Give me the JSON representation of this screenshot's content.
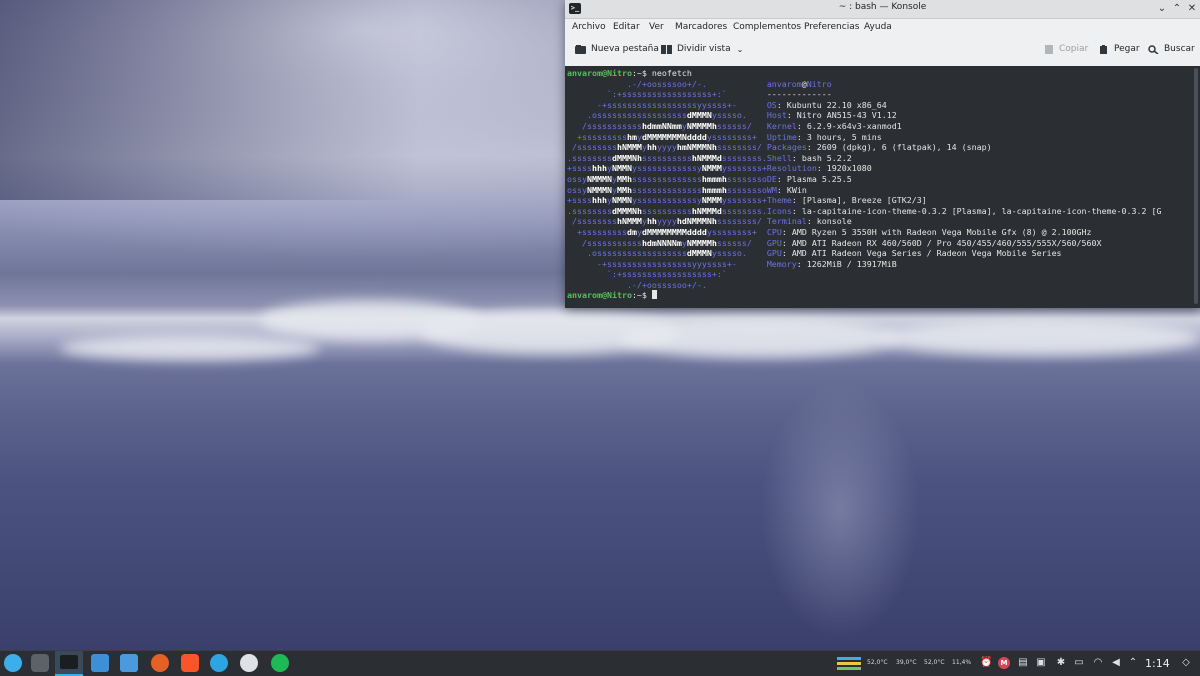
{
  "window": {
    "title": "~ : bash — Konsole",
    "title_icon": ">_",
    "controls": {
      "menu": "⌄",
      "minimize": "⌃",
      "close": "✕"
    }
  },
  "menubar": [
    "Archivo",
    "Editar",
    "Ver",
    "Marcadores",
    "Complementos",
    "Preferencias",
    "Ayuda"
  ],
  "toolbar": {
    "new_tab": "Nueva pestaña",
    "split_view": "Dividir vista",
    "copy": "Copiar",
    "paste": "Pegar",
    "search": "Buscar"
  },
  "terminal": {
    "user": "anvarom@Nitro",
    "prompt_suffix": ":~$",
    "command": "neofetch",
    "info_header": "anvarom@Nitro",
    "info_separator": "-------------",
    "info": [
      {
        "label": "OS",
        "value": "Kubuntu 22.10 x86_64"
      },
      {
        "label": "Host",
        "value": "Nitro AN515-43 V1.12"
      },
      {
        "label": "Kernel",
        "value": "6.2.9-x64v3-xanmod1"
      },
      {
        "label": "Uptime",
        "value": "3 hours, 5 mins"
      },
      {
        "label": "Packages",
        "value": "2609 (dpkg), 6 (flatpak), 14 (snap)"
      },
      {
        "label": "Shell",
        "value": "bash 5.2.2"
      },
      {
        "label": "Resolution",
        "value": "1920x1080"
      },
      {
        "label": "DE",
        "value": "Plasma 5.25.5"
      },
      {
        "label": "WM",
        "value": "KWin"
      },
      {
        "label": "Theme",
        "value": "[Plasma], Breeze [GTK2/3]"
      },
      {
        "label": "Icons",
        "value": "la-capitaine-icon-theme-0.3.2 [Plasma], la-capitaine-icon-theme-0.3.2 [G"
      },
      {
        "label": "Terminal",
        "value": "konsole"
      },
      {
        "label": "CPU",
        "value": "AMD Ryzen 5 3550H with Radeon Vega Mobile Gfx (8) @ 2.100GHz"
      },
      {
        "label": "GPU",
        "value": "AMD ATI Radeon RX 460/560D / Pro 450/455/460/555/555X/560/560X"
      },
      {
        "label": "GPU",
        "value": "AMD ATI Radeon Vega Series / Radeon Vega Mobile Series"
      },
      {
        "label": "Memory",
        "value": "1262MiB / 13917MiB"
      }
    ],
    "logo": [
      "            .-/+oossssoo+/-.",
      "        `:+ssssssssssssssssss+:`",
      "      -+ssssssssssssssssssyyssss+-",
      "    .ossssssssssssssssssdMMMNysssso.",
      "   /ssssssssssshdmmNNmmyNMMMMhssssss/",
      "  +ssssssssshmydMMMMMMMNddddyssssssss+",
      " /sssssssshNMMMyhhyyyyhmNMMMNhssssssss/",
      ".ssssssssdMMMNhsssssssssshNMMMdssssssss.",
      "+sssshhhyNMMNyssssssssssssyNMMMysssssss+",
      "ossyNMMMNyMMhsssssssssssssshmmmhssssssso",
      "ossyNMMMNyMMhsssssssssssssshmmmhssssssso",
      "+sssshhhyNMMNyssssssssssssyNMMMysssssss+",
      ".ssssssssdMMMNhsssssssssshNMMMdssssssss.",
      " /sssssssshNMMMyhhyyyyhdNMMMNhssssssss/",
      "  +sssssssssdmydMMMMMMMMddddyssssssss+",
      "   /ssssssssssshdmNNNNmyNMMMMhssssss/",
      "    .ossssssssssssssssssdMMMNysssso.",
      "      -+sssssssssssssssssyyyssss+-",
      "        `:+ssssssssssssssssss+:`",
      "            .-/+oossssoo+/-."
    ],
    "end_prompt": "anvarom@Nitro:~$"
  },
  "taskbar": {
    "apps": [
      "application-launcher-icon",
      "system-settings-icon",
      "konsole-icon",
      "discover-icon",
      "dolphin-icon",
      "firefox-icon",
      "brave-icon",
      "telegram-icon",
      "steam-icon",
      "spotify-icon"
    ],
    "tray": {
      "temp1": "52,0°C",
      "temp2": "39,0°C",
      "temp3": "52,0°C",
      "cpu": "11,4%"
    },
    "clock": "1:14"
  }
}
